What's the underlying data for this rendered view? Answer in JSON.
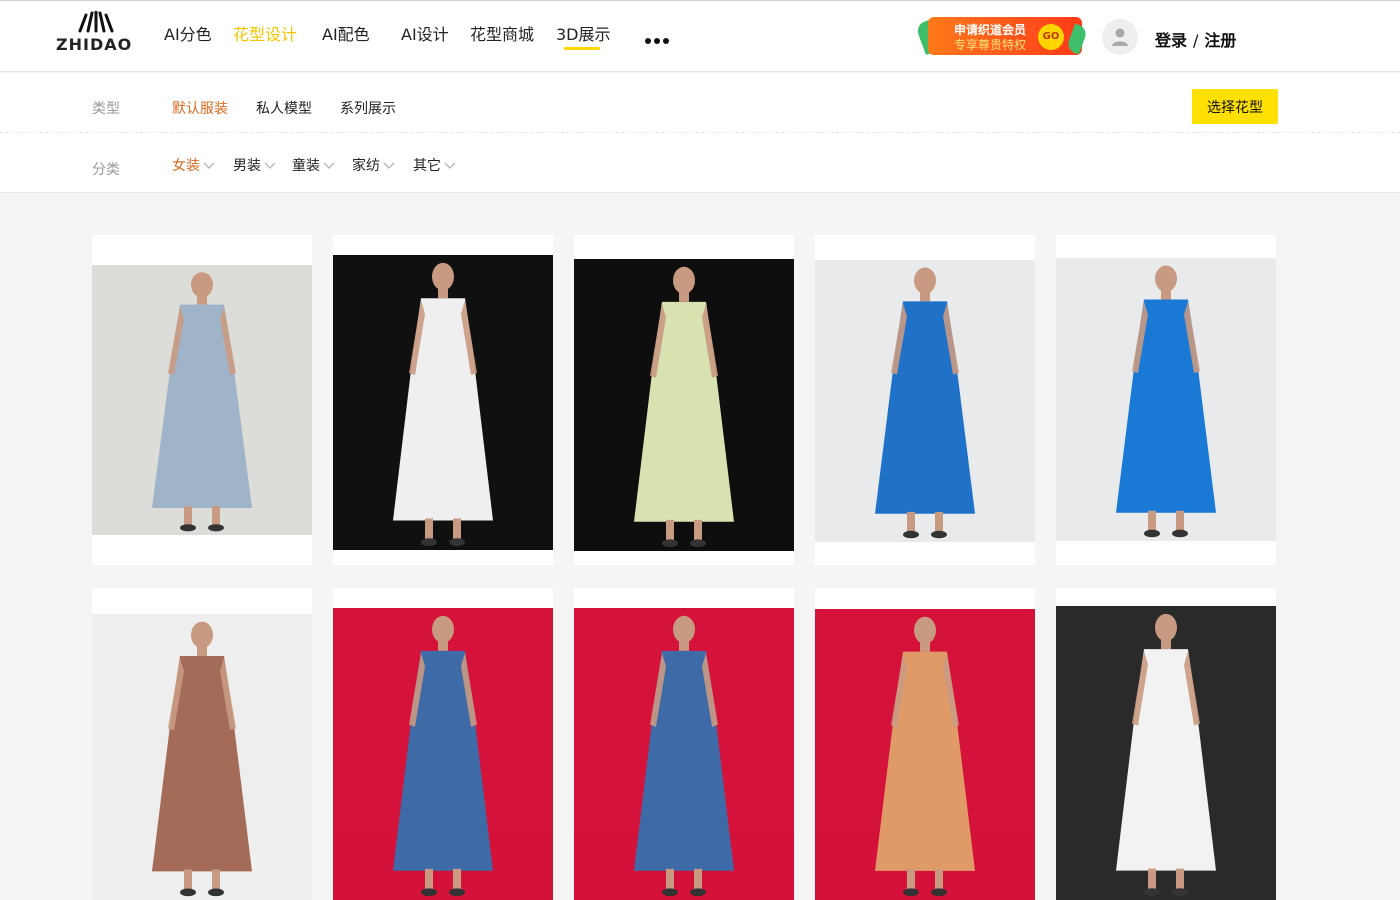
{
  "brand": {
    "name": "ZHIDAO",
    "accent": "#ffd800",
    "active_text": "#d9691f"
  },
  "nav": {
    "items": [
      {
        "label": "AI分色",
        "active": false
      },
      {
        "label": "花型设计",
        "active": true
      },
      {
        "label": "AI配色",
        "active": false
      },
      {
        "label": "AI设计",
        "active": false
      },
      {
        "label": "花型商城",
        "active": false
      },
      {
        "label": "3D展示",
        "active": false
      }
    ],
    "more_icon": "more-dots-icon"
  },
  "promo": {
    "line1": "申请织道会员",
    "line2": "专享尊贵特权",
    "go": "GO"
  },
  "account": {
    "login": "登录",
    "separator": "/",
    "register": "注册",
    "avatar_icon": "user-icon"
  },
  "filters": {
    "type_label": "类型",
    "types": [
      {
        "label": "默认服装",
        "active": true
      },
      {
        "label": "私人模型",
        "active": false
      },
      {
        "label": "系列展示",
        "active": false
      }
    ],
    "select_button": "选择花型",
    "category_label": "分类",
    "categories": [
      {
        "label": "女装",
        "active": true
      },
      {
        "label": "男装",
        "active": false
      },
      {
        "label": "童装",
        "active": false
      },
      {
        "label": "家纺",
        "active": false
      },
      {
        "label": "其它",
        "active": false
      }
    ]
  },
  "gallery": {
    "items": [
      {
        "subject": "light blue satin dress",
        "colors": [
          "#dcdcd8",
          "#9fb4c8"
        ]
      },
      {
        "subject": "white sleeveless jumpsuit",
        "colors": [
          "#101010",
          "#efefef"
        ]
      },
      {
        "subject": "pale green pleated dress",
        "colors": [
          "#0e0e0e",
          "#d8e2b0"
        ]
      },
      {
        "subject": "cobalt blue slip dress",
        "colors": [
          "#e9eaec",
          "#1f72c8"
        ]
      },
      {
        "subject": "royal blue asymmetric dress",
        "colors": [
          "#e8eaec",
          "#1a79d4"
        ]
      },
      {
        "subject": "mauve halter dress",
        "colors": [
          "#eeeeee",
          "#a46b59"
        ]
      },
      {
        "subject": "denim blue maxi dress",
        "colors": [
          "#d4123a",
          "#3f6aa8"
        ]
      },
      {
        "subject": "denim blue maxi dress",
        "colors": [
          "#d4123a",
          "#3f6aa8"
        ]
      },
      {
        "subject": "tan belted shirt dress",
        "colors": [
          "#d4123a",
          "#e09a68"
        ]
      },
      {
        "subject": "white draped cape with scarf",
        "colors": [
          "#2a2a2a",
          "#f2f2f2"
        ]
      }
    ]
  }
}
